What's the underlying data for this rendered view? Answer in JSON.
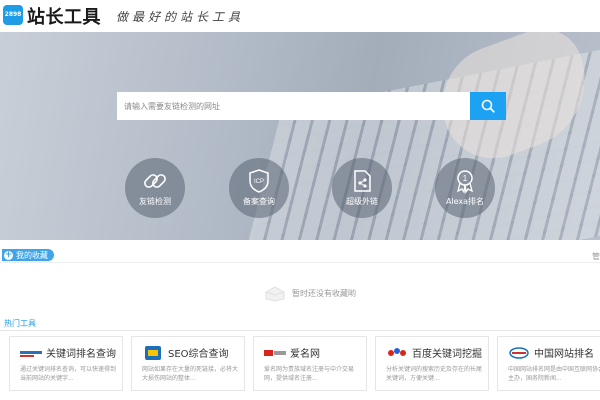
{
  "header": {
    "logo_badge": "2898",
    "logo_text": "站长工具",
    "slogan": "做最好的站长工具"
  },
  "search": {
    "placeholder": "请输入需要友链检测的网址"
  },
  "features": [
    {
      "label": "友链检测",
      "icon": "link-icon"
    },
    {
      "label": "备案查询",
      "icon": "icp-shield-icon"
    },
    {
      "label": "超级外链",
      "icon": "share-document-icon"
    },
    {
      "label": "Alexa排名",
      "icon": "medal-icon"
    }
  ],
  "favorites": {
    "tab_label": "我的收藏",
    "manage_label": "管",
    "empty_text": "暂时还没有收藏哟"
  },
  "hot_tools": {
    "title": "热门工具",
    "cards": [
      {
        "title": "关键词排名查询",
        "desc": "通过关键词排名查询，可以快速得到当前网站的关键字...",
        "icon": "keyword-logo-icon"
      },
      {
        "title": "SEO综合查询",
        "desc": "网站如果存在大量的死链接，必将大大损伤网站的整体...",
        "icon": "seo-logo-icon"
      },
      {
        "title": "爱名网",
        "desc": "爱名网为贵族域名注册与中介交易网，提供域名注册...",
        "icon": "22cn-logo-icon"
      },
      {
        "title": "百度关键词挖掘",
        "desc": "分析关键词的搜索历史及存在的长尾关键词，方便关键...",
        "icon": "baidu-logo-icon"
      },
      {
        "title": "中国网站排名",
        "desc": "中国网站排名网是由中国互联网协会主办，国务院新闻...",
        "icon": "china-rank-logo-icon"
      }
    ]
  },
  "colors": {
    "accent": "#1da1f2",
    "brand": "#1e9ce6"
  }
}
